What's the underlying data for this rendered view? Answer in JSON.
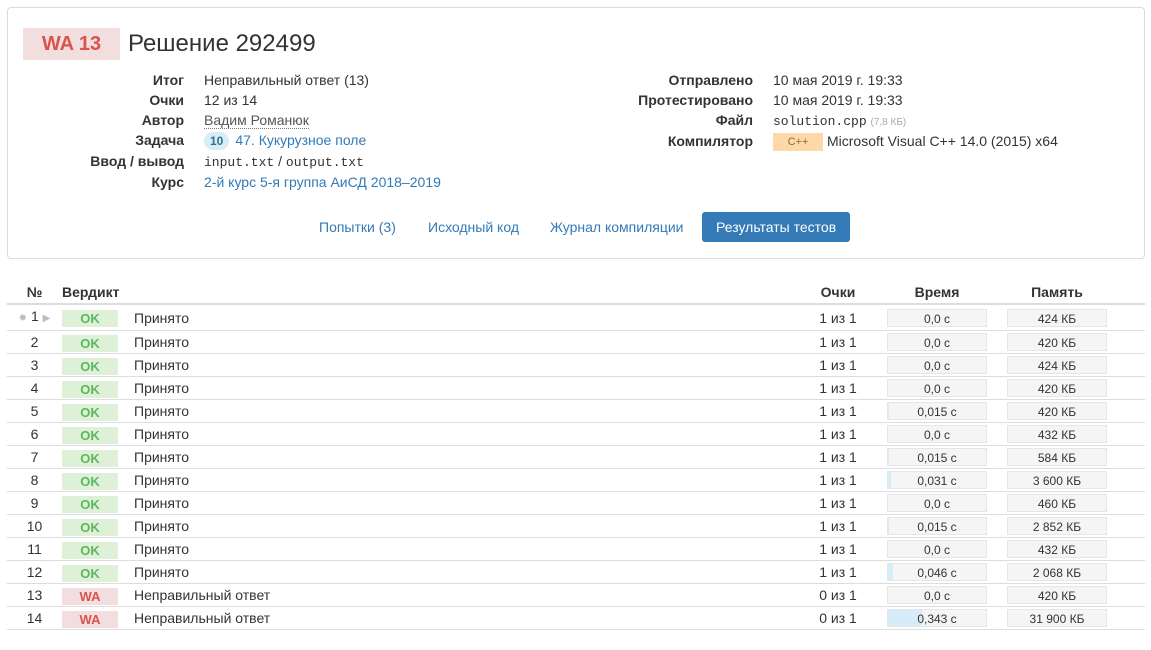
{
  "header": {
    "verdict_badge": "WA 13",
    "title": "Решение 292499"
  },
  "info_left": {
    "itog_label": "Итог",
    "itog_value": "Неправильный ответ (13)",
    "points_label": "Очки",
    "points_value": "12 из 14",
    "author_label": "Автор",
    "author_value": "Вадим Романюк",
    "task_label": "Задача",
    "task_badge": "10",
    "task_value": "47. Кукурузное поле",
    "io_label": "Ввод / вывод",
    "io_input": "input.txt",
    "io_sep": " / ",
    "io_output": "output.txt",
    "course_label": "Курс",
    "course_value": "2-й курс 5-я группа АиСД 2018–2019"
  },
  "info_right": {
    "sent_label": "Отправлено",
    "sent_value": "10 мая 2019 г. 19:33",
    "tested_label": "Протестировано",
    "tested_value": "10 мая 2019 г. 19:33",
    "file_label": "Файл",
    "file_value": "solution.cpp",
    "file_size": "(7,8 КБ)",
    "compiler_label": "Компилятор",
    "compiler_badge": "C++",
    "compiler_value": "Microsoft Visual C++ 14.0 (2015) x64"
  },
  "tabs": {
    "attempts": "Попытки (3)",
    "source": "Исходный код",
    "compile_log": "Журнал компиляции",
    "results": "Результаты тестов"
  },
  "table": {
    "headers": {
      "num": "№",
      "verdict": "Вердикт",
      "points": "Очки",
      "time": "Время",
      "memory": "Память"
    },
    "rows": [
      {
        "num": "1",
        "verdict": "OK",
        "desc": "Принято",
        "points": "1 из 1",
        "time": "0,0 с",
        "time_frac": 0,
        "memory": "424 КБ",
        "mem_frac": 0
      },
      {
        "num": "2",
        "verdict": "OK",
        "desc": "Принято",
        "points": "1 из 1",
        "time": "0,0 с",
        "time_frac": 0,
        "memory": "420 КБ",
        "mem_frac": 0
      },
      {
        "num": "3",
        "verdict": "OK",
        "desc": "Принято",
        "points": "1 из 1",
        "time": "0,0 с",
        "time_frac": 0,
        "memory": "424 КБ",
        "mem_frac": 0
      },
      {
        "num": "4",
        "verdict": "OK",
        "desc": "Принято",
        "points": "1 из 1",
        "time": "0,0 с",
        "time_frac": 0,
        "memory": "420 КБ",
        "mem_frac": 0
      },
      {
        "num": "5",
        "verdict": "OK",
        "desc": "Принято",
        "points": "1 из 1",
        "time": "0,015 с",
        "time_frac": 0.015,
        "memory": "420 КБ",
        "mem_frac": 0
      },
      {
        "num": "6",
        "verdict": "OK",
        "desc": "Принято",
        "points": "1 из 1",
        "time": "0,0 с",
        "time_frac": 0,
        "memory": "432 КБ",
        "mem_frac": 0
      },
      {
        "num": "7",
        "verdict": "OK",
        "desc": "Принято",
        "points": "1 из 1",
        "time": "0,015 с",
        "time_frac": 0.015,
        "memory": "584 КБ",
        "mem_frac": 0
      },
      {
        "num": "8",
        "verdict": "OK",
        "desc": "Принято",
        "points": "1 из 1",
        "time": "0,031 с",
        "time_frac": 0.031,
        "memory": "3 600 КБ",
        "mem_frac": 0
      },
      {
        "num": "9",
        "verdict": "OK",
        "desc": "Принято",
        "points": "1 из 1",
        "time": "0,0 с",
        "time_frac": 0,
        "memory": "460 КБ",
        "mem_frac": 0
      },
      {
        "num": "10",
        "verdict": "OK",
        "desc": "Принято",
        "points": "1 из 1",
        "time": "0,015 с",
        "time_frac": 0.015,
        "memory": "2 852 КБ",
        "mem_frac": 0
      },
      {
        "num": "11",
        "verdict": "OK",
        "desc": "Принято",
        "points": "1 из 1",
        "time": "0,0 с",
        "time_frac": 0,
        "memory": "432 КБ",
        "mem_frac": 0
      },
      {
        "num": "12",
        "verdict": "OK",
        "desc": "Принято",
        "points": "1 из 1",
        "time": "0,046 с",
        "time_frac": 0.046,
        "memory": "2 068 КБ",
        "mem_frac": 0
      },
      {
        "num": "13",
        "verdict": "WA",
        "desc": "Неправильный ответ",
        "points": "0 из 1",
        "time": "0,0 с",
        "time_frac": 0,
        "memory": "420 КБ",
        "mem_frac": 0
      },
      {
        "num": "14",
        "verdict": "WA",
        "desc": "Неправильный ответ",
        "points": "0 из 1",
        "time": "0,343 с",
        "time_frac": 0.343,
        "memory": "31 900 КБ",
        "mem_frac": 0
      }
    ]
  }
}
